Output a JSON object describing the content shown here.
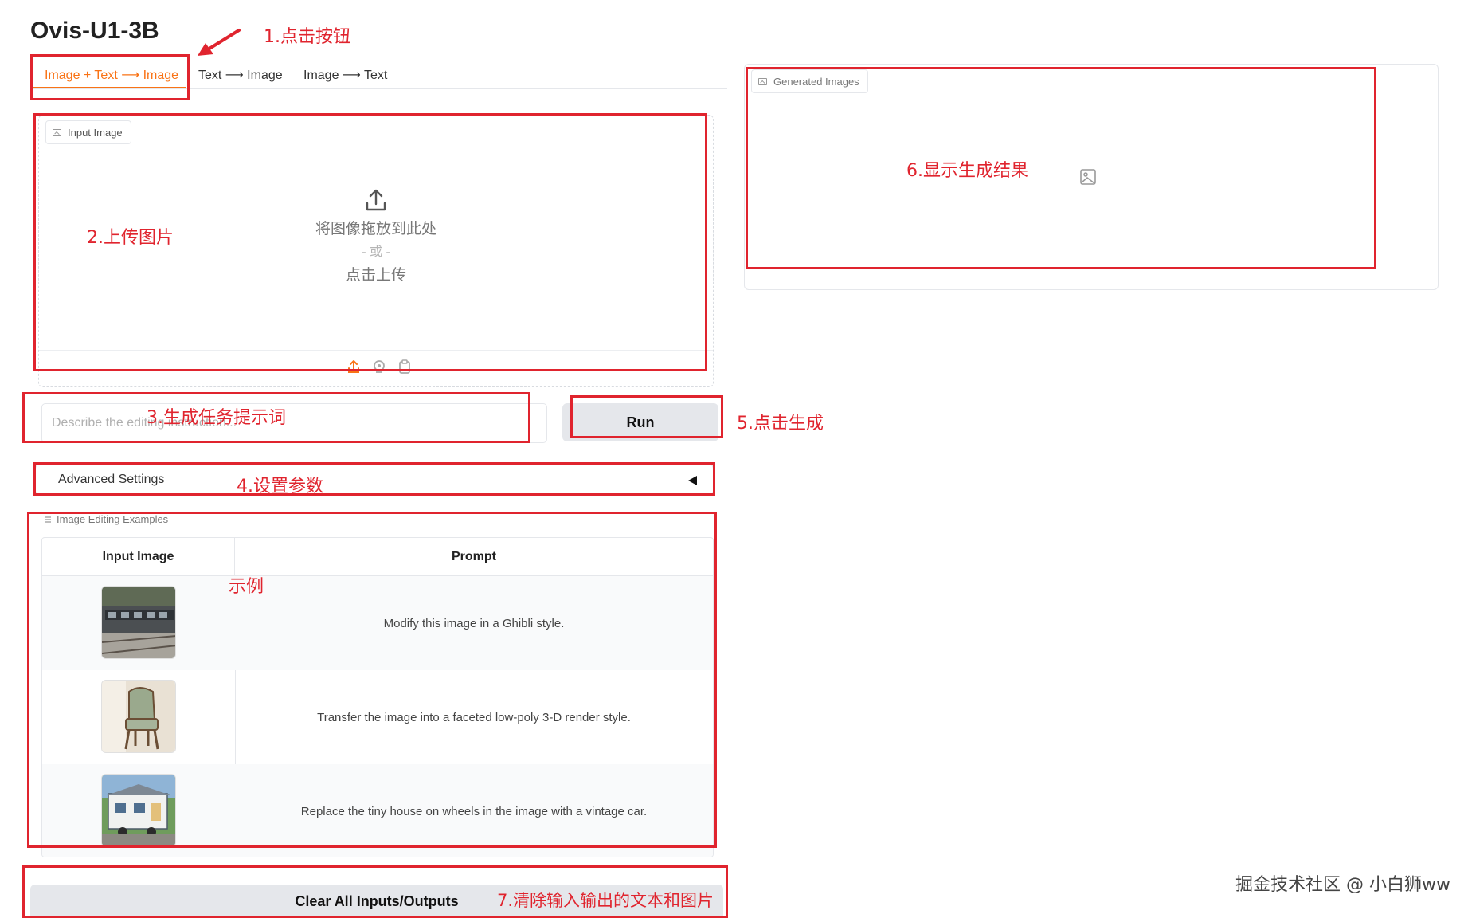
{
  "app": {
    "title": "Ovis-U1-3B"
  },
  "tabs": [
    {
      "label": "Image + Text ⟶ Image",
      "active": true
    },
    {
      "label": "Text ⟶ Image",
      "active": false
    },
    {
      "label": "Image ⟶ Text",
      "active": false
    }
  ],
  "input_image": {
    "label": "Input Image",
    "drop_text": "将图像拖放到此处",
    "or_text": "- 或 -",
    "click_text": "点击上传",
    "sources": [
      "upload-icon",
      "webcam-icon",
      "clipboard-icon"
    ]
  },
  "generated": {
    "label": "Generated Images"
  },
  "prompt": {
    "placeholder": "Describe the editing instruction..."
  },
  "run": {
    "label": "Run"
  },
  "advanced": {
    "label": "Advanced Settings"
  },
  "examples": {
    "label": "Image Editing Examples",
    "columns": [
      "Input Image",
      "Prompt"
    ],
    "rows": [
      {
        "prompt": "Modify this image in a Ghibli style."
      },
      {
        "prompt": "Transfer the image into a faceted low-poly 3-D render style."
      },
      {
        "prompt": "Replace the tiny house on wheels in the image with a vintage car."
      }
    ]
  },
  "clear": {
    "label": "Clear All Inputs/Outputs"
  },
  "annotations": {
    "a1": "1.点击按钮",
    "a2": "2.上传图片",
    "a3": "3.生成任务提示词",
    "a4": "4.设置参数",
    "a5": "5.点击生成",
    "a6": "6.显示生成结果",
    "a7": "7.清除输入输出的文本和图片",
    "example": "示例"
  },
  "watermark": "掘金技术社区 @ 小白狮ww",
  "colors": {
    "accent": "#f97316",
    "annotation_red": "#e0242e",
    "button_gray": "#e5e7eb"
  }
}
